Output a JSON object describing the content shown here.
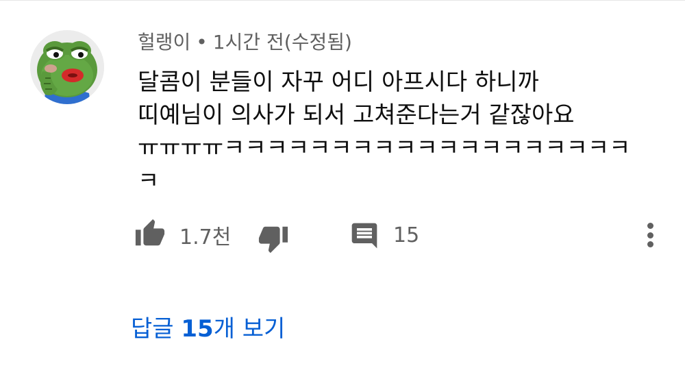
{
  "comment": {
    "author": "헐랭이",
    "separator": "•",
    "time": "1시간 전(수정됨)",
    "text": "달콤이 분들이 자꾸 어디 아프시다 하니까\n띠예님이 의사가 되서 고쳐준다는거 같잖아요\nㅠㅠㅠㅠㅋㅋㅋㅋㅋㅋㅋㅋㅋㅋㅋㅋㅋㅋㅋㅋㅋㅋㅋ\nㅋ"
  },
  "actions": {
    "like_count": "1.7천",
    "reply_count": "15",
    "like_icon": "thumb-up-icon",
    "dislike_icon": "thumb-down-icon",
    "reply_icon": "comment-icon",
    "more_icon": "more-vertical-icon"
  },
  "replies": {
    "prefix": "답글 ",
    "count": "15",
    "suffix": "개 보기"
  },
  "colors": {
    "meta": "#606060",
    "text": "#0f0f0f",
    "link": "#065fd4",
    "icon": "#606060"
  }
}
